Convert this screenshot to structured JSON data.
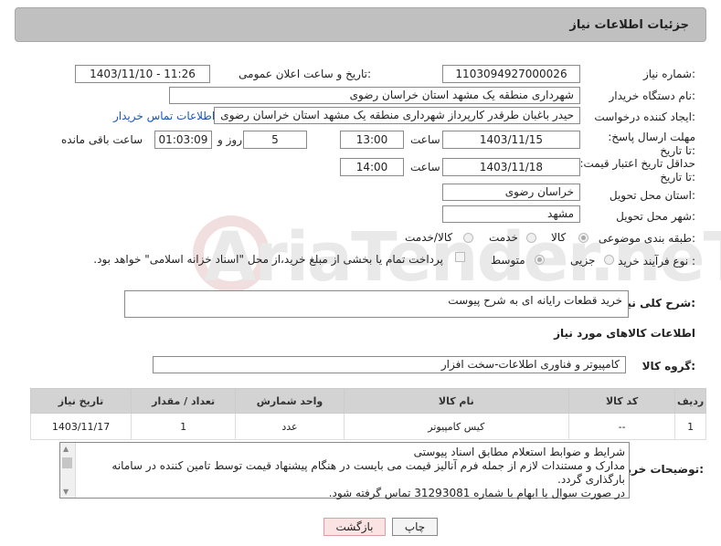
{
  "header": {
    "title": "جزئیات اطلاعات نیاز"
  },
  "fields": {
    "need_number_label": "شماره نیاز:",
    "need_number": "1103094927000026",
    "announce_label": "تاریخ و ساعت اعلان عمومی:",
    "announce_value": "1403/11/10 - 11:26",
    "buyer_org_label": "نام دستگاه خریدار:",
    "buyer_org": "شهرداری منطقه یک مشهد استان خراسان رضوی",
    "requester_label": "ایجاد کننده درخواست:",
    "requester": "حیدر باغبان طرقدر کارپرداز شهرداری منطقه یک مشهد استان خراسان رضوی",
    "contact_link": "اطلاعات تماس خریدار",
    "deadline_label": "مهلت ارسال پاسخ: تا تاریخ:",
    "deadline_date": "1403/11/15",
    "time_word": "ساعت",
    "deadline_time": "13:00",
    "days": "5",
    "day_word": "روز و",
    "remaining": "01:03:09",
    "remaining_suffix": "ساعت باقی مانده",
    "price_valid_label": "حداقل تاریخ اعتبار قیمت: تا تاریخ:",
    "price_valid_date": "1403/11/18",
    "price_valid_time": "14:00",
    "province_label": "استان محل تحویل:",
    "province": "خراسان رضوی",
    "city_label": "شهر محل تحویل:",
    "city": "مشهد",
    "category_label": "طبقه بندی موضوعی:",
    "cat_goods": "کالا",
    "cat_service": "خدمت",
    "cat_goods_service": "کالا/خدمت",
    "process_label": "نوع فرآیند خرید :",
    "proc_minor": "جزیی",
    "proc_medium": "متوسط",
    "payment_note": "پرداخت تمام یا بخشی از مبلغ خرید،از محل \"اسناد خزانه اسلامی\" خواهد بود.",
    "desc_label": "شرح کلی نیاز:",
    "desc": "خرید قطعات رایانه ای به شرح پیوست",
    "goods_info_title": "اطلاعات کالاهای مورد نیاز",
    "group_label": "گروه کالا:",
    "group": "کامپیوتر و فناوری اطلاعات-سخت افزار"
  },
  "table": {
    "headers": [
      "ردیف",
      "کد کالا",
      "نام کالا",
      "واحد شمارش",
      "تعداد / مقدار",
      "تاریخ نیاز"
    ],
    "rows": [
      [
        "1",
        "--",
        "کیس کامپیوتر",
        "عدد",
        "1",
        "1403/11/17"
      ]
    ]
  },
  "notes": {
    "label": "توضیحات خریدار:",
    "text": "شرایط و ضوابط استعلام مطابق اسناد پیوستی\nمدارک و مستندات لازم از جمله فرم آنالیز قیمت می بایست در هنگام پیشنهاد قیمت توسط تامین کننده در سامانه بارگذاری گردد.\nدر صورت سوال یا ابهام با شماره 31293081 تماس گرفته شود."
  },
  "buttons": {
    "print": "چاپ",
    "back": "بازگشت"
  },
  "watermark": "AriaTender.neT",
  "colors": {
    "header_bg": "#c0c0c0",
    "link": "#1a56b5",
    "back_btn": "#fbe3e3"
  }
}
